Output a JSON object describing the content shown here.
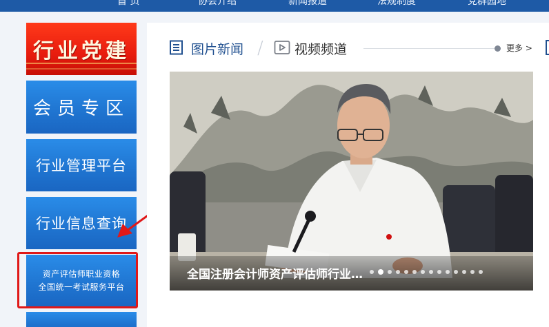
{
  "top_nav": {
    "items": [
      "首  页",
      "协会介绍",
      "新闻报道",
      "法规制度",
      "党群园地"
    ]
  },
  "left_menu": {
    "party": "行业党建",
    "member": "会员专区",
    "platform": "行业管理平台",
    "query": "行业信息查询",
    "exam_line1": "资产评估师职业资格",
    "exam_line2": "全国统一考试服务平台"
  },
  "tabs": {
    "photo_news": "图片新闻",
    "video_channel": "视频频道",
    "more": "更多 >"
  },
  "slider": {
    "caption": "全国注册会计师资产评估师行业…",
    "dot_count": 14,
    "active_index": 1
  },
  "colors": {
    "nav_blue": "#1e5aa6",
    "tile_blue": "#1f74d0",
    "party_red": "#e81c0e",
    "highlight_red": "#e01818"
  }
}
